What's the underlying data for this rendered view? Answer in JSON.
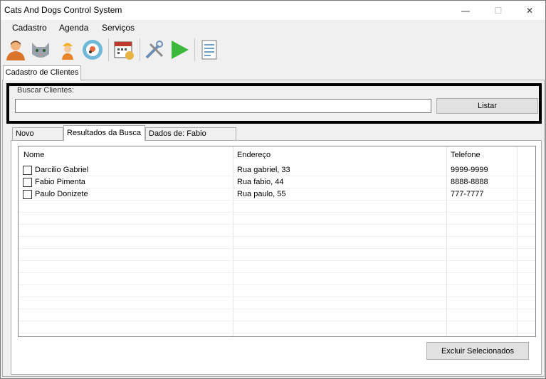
{
  "window": {
    "title": "Cats And Dogs Control System",
    "minimize_glyph": "—",
    "maximize_glyph": "☐",
    "close_glyph": "✕"
  },
  "menu": {
    "items": [
      "Cadastro",
      "Agenda",
      "Serviços"
    ]
  },
  "toolbar": {
    "icons": [
      "person-icon",
      "cat-icon",
      "worker-icon",
      "pet-gear-icon",
      "calendar-icon",
      "tools-icon",
      "play-icon",
      "report-icon"
    ]
  },
  "outer_tab": {
    "label": "Cadastro de Clientes"
  },
  "search": {
    "label": "Buscar Clientes:",
    "value": "",
    "button": "Listar"
  },
  "inner_tabs": [
    "Novo Cliente",
    "Resultados da Busca",
    "Dados de: Fabio Pimenta"
  ],
  "active_inner_tab": "Resultados da Busca",
  "table": {
    "columns": [
      "Nome",
      "Endereço",
      "Telefone"
    ],
    "rows": [
      {
        "nome": "Darcilio Gabriel",
        "endereco": "Rua gabriel, 33",
        "telefone": "9999-9999",
        "checked": false
      },
      {
        "nome": "Fabio Pimenta",
        "endereco": "Rua fabio, 44",
        "telefone": "8888-8888",
        "checked": false
      },
      {
        "nome": "Paulo Donizete",
        "endereco": "Rua paulo, 55",
        "telefone": "777-7777",
        "checked": false
      }
    ]
  },
  "actions": {
    "delete_selected": "Excluir Selecionados"
  }
}
